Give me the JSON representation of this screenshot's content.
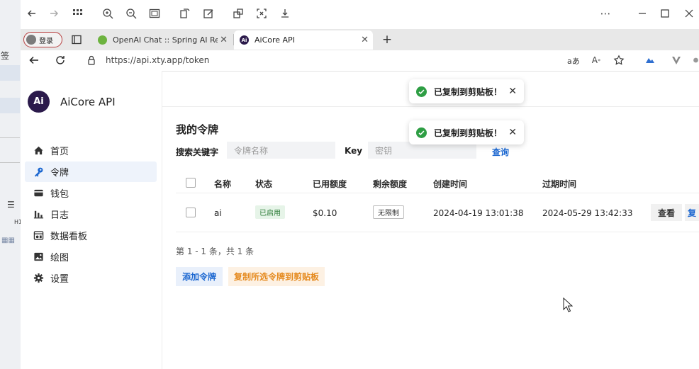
{
  "browser": {
    "profile_label": "登录",
    "tabs": [
      {
        "title": "OpenAI Chat :: Spring AI Referen",
        "active": false
      },
      {
        "title": "AiCore API",
        "active": true
      }
    ],
    "url": "https://api.xty.app/token",
    "reader_label": "aあ"
  },
  "background_window": {
    "fragments": [
      "签",
      "H1"
    ]
  },
  "sidebar": {
    "logo_text": "Ai",
    "brand": "AiCore API",
    "items": [
      {
        "label": "首页",
        "icon": "home-icon",
        "active": false
      },
      {
        "label": "令牌",
        "icon": "key-icon",
        "active": true
      },
      {
        "label": "钱包",
        "icon": "wallet-icon",
        "active": false
      },
      {
        "label": "日志",
        "icon": "bar-chart-icon",
        "active": false
      },
      {
        "label": "数据看板",
        "icon": "dashboard-icon",
        "active": false
      },
      {
        "label": "绘图",
        "icon": "image-icon",
        "active": false
      },
      {
        "label": "设置",
        "icon": "gear-icon",
        "active": false
      }
    ]
  },
  "main": {
    "title": "我的令牌",
    "search": {
      "keyword_label": "搜索关键字",
      "name_placeholder": "令牌名称",
      "key_label": "Key",
      "key_placeholder": "密钥",
      "query_button": "查询"
    },
    "table": {
      "headers": [
        "名称",
        "状态",
        "已用额度",
        "剩余额度",
        "创建时间",
        "过期时间"
      ],
      "rows": [
        {
          "name": "ai",
          "status": "已启用",
          "used": "$0.10",
          "remaining": "无限制",
          "created": "2024-04-19 13:01:38",
          "expires": "2024-05-29 13:42:33",
          "view_button": "查看",
          "copy_button": "复"
        }
      ]
    },
    "pagination": "第 1 - 1 条，共 1 条",
    "add_button": "添加令牌",
    "copy_selected_button": "复制所选令牌到剪贴板"
  },
  "toasts": [
    {
      "message": "已复制到剪贴板！"
    },
    {
      "message": "已复制到剪贴板！"
    }
  ],
  "colors": {
    "accent": "#1a66d0",
    "success": "#2e9e44",
    "warning": "#e58a1f",
    "active_nav": "#eef3fb"
  }
}
